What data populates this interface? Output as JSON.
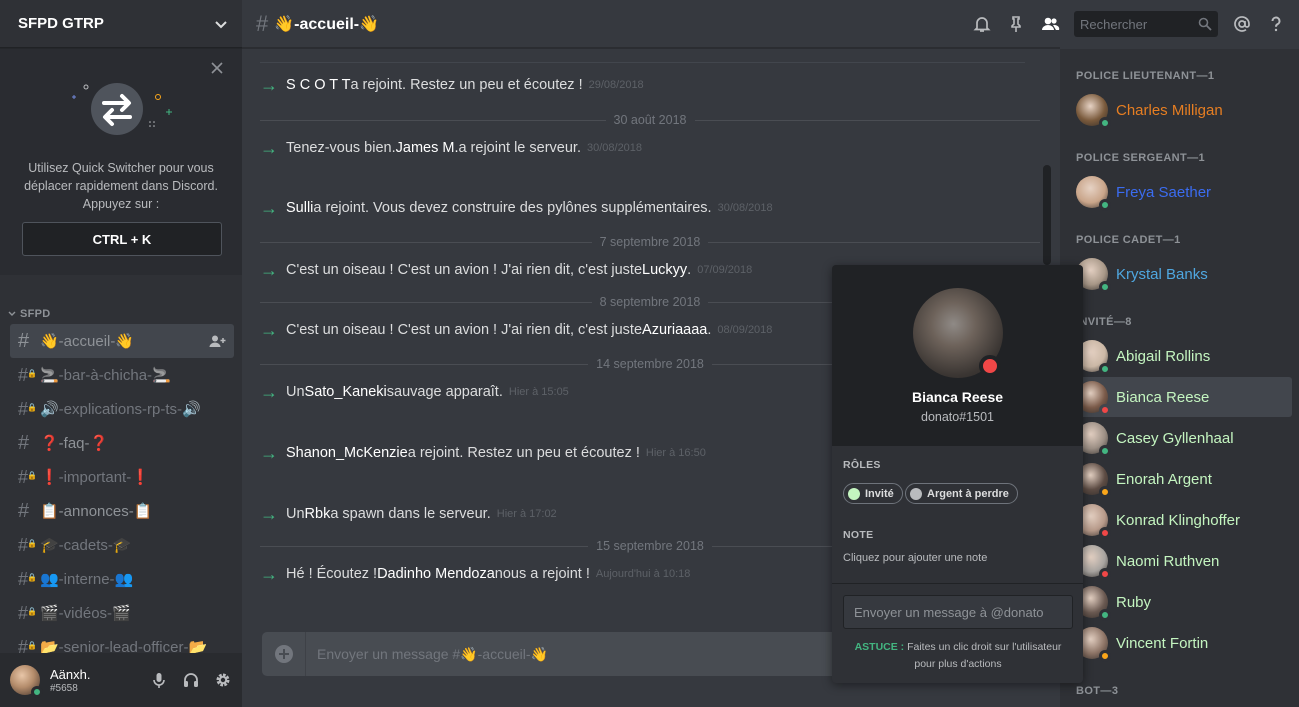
{
  "guild": {
    "name": "SFPD GTRP"
  },
  "quick_switcher": {
    "text": "Utilisez Quick Switcher pour vous déplacer rapidement dans Discord. Appuyez sur :",
    "shortcut": "CTRL + K"
  },
  "sidebar": {
    "category": "SFPD",
    "channels": [
      {
        "label": "👋-accueil-👋",
        "active": true,
        "locked": false
      },
      {
        "label": "🚬-bar-à-chicha-🚬",
        "active": false,
        "locked": true
      },
      {
        "label": "🔊-explications-rp-ts-🔊",
        "active": false,
        "locked": true
      },
      {
        "label": "❓-faq-❓",
        "active": false,
        "locked": false
      },
      {
        "label": "❗-important-❗",
        "active": false,
        "locked": true
      },
      {
        "label": "📋-annonces-📋",
        "active": false,
        "locked": false
      },
      {
        "label": "🎓-cadets-🎓",
        "active": false,
        "locked": true
      },
      {
        "label": "👥-interne-👥",
        "active": false,
        "locked": true
      },
      {
        "label": "🎬-vidéos-🎬",
        "active": false,
        "locked": true
      },
      {
        "label": "📂-senior-lead-officer-📂",
        "active": false,
        "locked": true
      }
    ]
  },
  "user": {
    "name": "Aänxh.",
    "tag": "#5658",
    "status": "online"
  },
  "channel": {
    "title": "👋-accueil-👋"
  },
  "header": {
    "search_placeholder": "Rechercher"
  },
  "messages": {
    "items": [
      {
        "kind": "msg",
        "pre": "",
        "name": "S C O T T",
        "post": " a rejoint. Restez un peu et écoutez !",
        "ts": "29/08/2018"
      },
      {
        "kind": "div",
        "label": "30 août 2018"
      },
      {
        "kind": "msg",
        "pre": "Tenez-vous bien. ",
        "name": "James M.",
        "post": " a rejoint le serveur.",
        "ts": "30/08/2018"
      },
      {
        "kind": "msg",
        "pre": "",
        "name": "Sulli",
        "post": " a rejoint. Vous devez construire des pylônes supplémentaires.",
        "ts": "30/08/2018"
      },
      {
        "kind": "div",
        "label": "7 septembre 2018"
      },
      {
        "kind": "msg",
        "pre": "C'est un oiseau ! C'est un avion ! J'ai rien dit, c'est juste ",
        "name": "Luckyy",
        "post": ".",
        "ts": "07/09/2018"
      },
      {
        "kind": "div",
        "label": "8 septembre 2018"
      },
      {
        "kind": "msg",
        "pre": "C'est un oiseau ! C'est un avion ! J'ai rien dit, c'est juste ",
        "name": "Azuriaaaa",
        "post": ".",
        "ts": "08/09/2018"
      },
      {
        "kind": "div",
        "label": "14 septembre 2018"
      },
      {
        "kind": "msg",
        "pre": "Un ",
        "name": "Sato_Kaneki",
        "post": " sauvage apparaît.",
        "ts": "Hier à 15:05"
      },
      {
        "kind": "msg",
        "pre": "",
        "name": "Shanon_McKenzie",
        "post": " a rejoint. Restez un peu et écoutez !",
        "ts": "Hier à 16:50"
      },
      {
        "kind": "msg",
        "pre": "Un ",
        "name": "Rbk",
        "post": " a spawn dans le serveur.",
        "ts": "Hier à 17:02"
      },
      {
        "kind": "div",
        "label": "15 septembre 2018"
      },
      {
        "kind": "msg",
        "pre": "Hé ! Écoutez ! ",
        "name": "Dadinho Mendoza",
        "post": " nous a rejoint !",
        "ts": "Aujourd'hui à 10:18"
      }
    ]
  },
  "composer": {
    "placeholder": "Envoyer un message #👋-accueil-👋"
  },
  "members": {
    "groups": [
      {
        "title": "POLICE LIEUTENANT—1",
        "color": "#e67e22",
        "members": [
          {
            "name": "Charles Milligan",
            "status": "online"
          }
        ]
      },
      {
        "title": "POLICE SERGEANT—1",
        "color": "#3b6cf0",
        "members": [
          {
            "name": "Freya Saether",
            "status": "online"
          }
        ]
      },
      {
        "title": "POLICE CADET—1",
        "color": "#4fa7e0",
        "members": [
          {
            "name": "Krystal Banks",
            "status": "online"
          }
        ]
      },
      {
        "title": "INVITÉ—8",
        "color": "#c4f5c0",
        "members": [
          {
            "name": "Abigail Rollins",
            "status": "online"
          },
          {
            "name": "Bianca Reese",
            "status": "dnd",
            "selected": true
          },
          {
            "name": "Casey Gyllenhaal",
            "status": "online"
          },
          {
            "name": "Enorah Argent",
            "status": "idle"
          },
          {
            "name": "Konrad Klinghoffer",
            "status": "dnd"
          },
          {
            "name": "Naomi Ruthven",
            "status": "dnd"
          },
          {
            "name": "Ruby",
            "status": "online"
          },
          {
            "name": "Vincent Fortin",
            "status": "idle"
          }
        ]
      },
      {
        "title": "BOT—3",
        "color": "#8e9297",
        "members": []
      }
    ]
  },
  "popout": {
    "name": "Bianca Reese",
    "tag": "donato#1501",
    "roles_label": "RÔLES",
    "roles": [
      {
        "name": "Invité",
        "color": "#c4f5c0"
      },
      {
        "name": "Argent à perdre",
        "color": "#b9bbbe"
      }
    ],
    "note_label": "NOTE",
    "note_placeholder": "Cliquez pour ajouter une note",
    "message_placeholder": "Envoyer un message à @donato",
    "tip_key": "ASTUCE :",
    "tip_text": " Faites un clic droit sur l'utilisateur pour plus d'actions"
  }
}
